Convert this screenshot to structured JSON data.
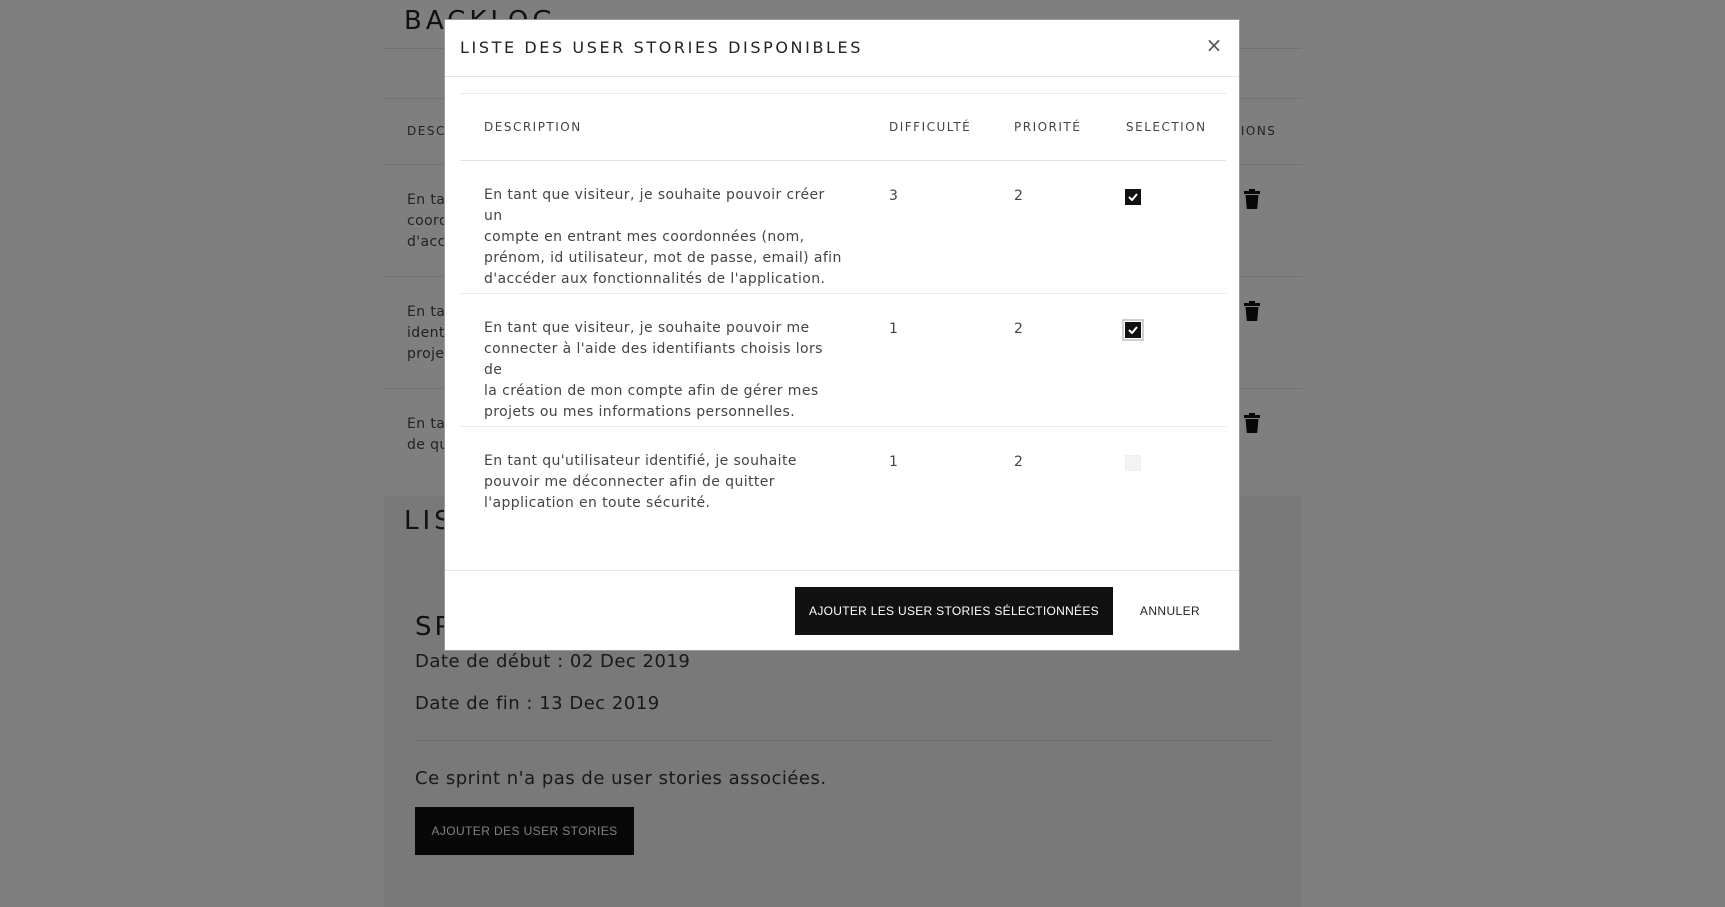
{
  "background": {
    "backlog_title": "BACKLOG",
    "table_head_left": "DESC",
    "table_head_right": "TIONS",
    "rows": [
      {
        "lines": [
          "En ta",
          "coord",
          "d'acc"
        ]
      },
      {
        "lines": [
          "En ta",
          "ident",
          "proje"
        ]
      },
      {
        "lines": [
          "En ta",
          "de qu"
        ]
      }
    ],
    "list_title": "LIS",
    "sprint_title": "SP",
    "start_date": "Date de début : 02 Dec 2019",
    "end_date": "Date de fin : 13 Dec 2019",
    "no_stories": "Ce sprint n'a pas de user stories associées.",
    "add_stories_button": "AJOUTER DES USER STORIES"
  },
  "modal": {
    "title": "LISTE DES USER STORIES DISPONIBLES",
    "close_glyph": "×",
    "columns": {
      "description": "DESCRIPTION",
      "difficulty": "DIFFICULTÉ",
      "priority": "PRIORITÉ",
      "selection": "SELECTION"
    },
    "stories": [
      {
        "lines": [
          "En tant que visiteur, je souhaite pouvoir créer un",
          "compte en entrant mes coordonnées (nom,",
          "prénom, id utilisateur, mot de passe, email) afin",
          "d'accéder aux fonctionnalités de l'application."
        ],
        "difficulty": "3",
        "priority": "2",
        "selected": true
      },
      {
        "lines": [
          "En tant que visiteur, je souhaite pouvoir me",
          "connecter à l'aide des identifiants choisis lors de",
          "la création de mon compte afin de gérer mes",
          "projets ou mes informations personnelles."
        ],
        "difficulty": "1",
        "priority": "2",
        "selected": true
      },
      {
        "lines": [
          "En tant qu'utilisateur identifié, je souhaite",
          "pouvoir me déconnecter afin de quitter",
          "l'application en toute sécurité."
        ],
        "difficulty": "1",
        "priority": "2",
        "selected": false
      }
    ],
    "primary_button": "AJOUTER LES USER STORIES SÉLECTIONNÉES",
    "cancel_button": "ANNULER"
  },
  "icons": {
    "trash": "trash-icon",
    "check": "check-icon",
    "close": "close-icon"
  },
  "colors": {
    "overlay": "#000000",
    "button_bg": "#111111",
    "button_text": "#ffffff"
  }
}
